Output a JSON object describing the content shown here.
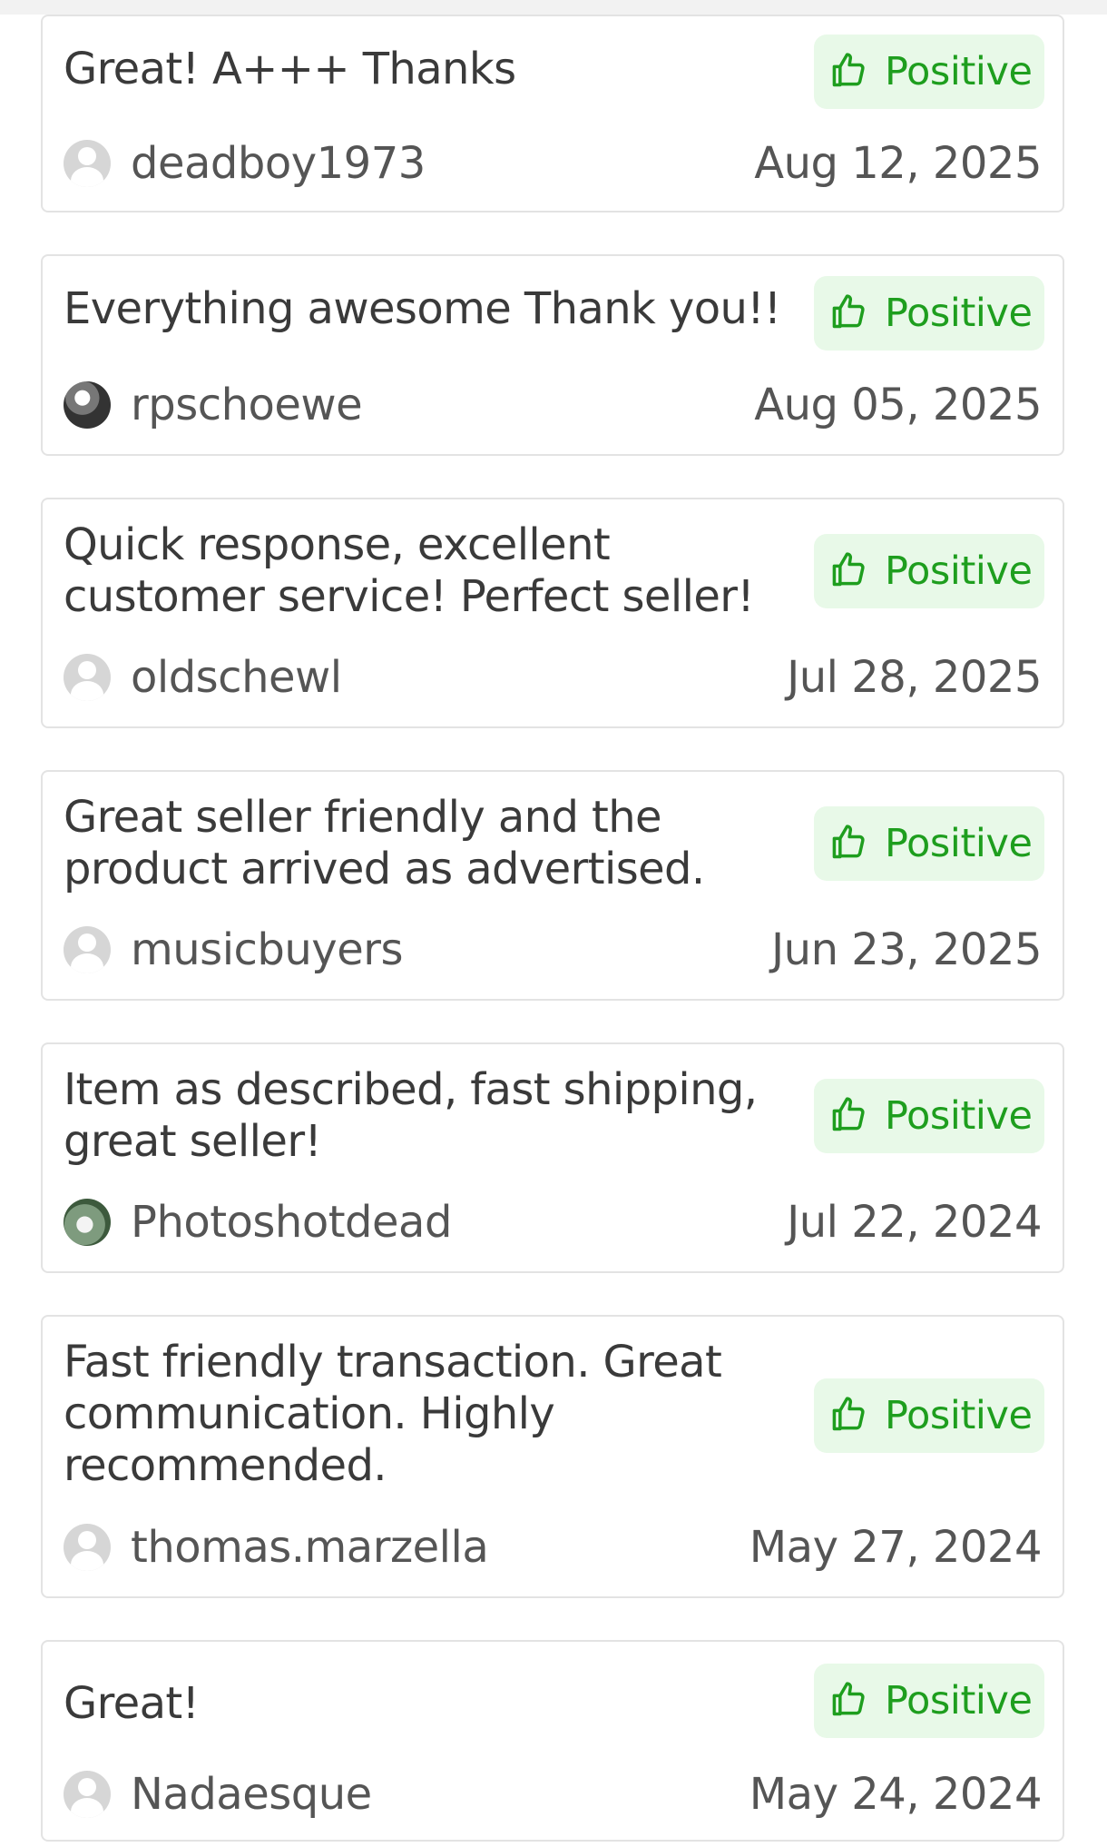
{
  "feedback": [
    {
      "comment": "Great! A+++ Thanks",
      "rating": "Positive",
      "user": "deadboy1973",
      "date": "Aug 12, 2025",
      "avatar_type": "default-avatar"
    },
    {
      "comment": "Everything awesome Thank you!!",
      "rating": "Positive",
      "user": "rpschoewe",
      "date": "Aug 05, 2025",
      "avatar_type": "user-photo"
    },
    {
      "comment": "Quick response, excellent customer service! Perfect seller!",
      "rating": "Positive",
      "user": "oldschewl",
      "date": "Jul 28, 2025",
      "avatar_type": "default-avatar"
    },
    {
      "comment": "Great seller friendly and the product arrived as advertised.",
      "rating": "Positive",
      "user": "musicbuyers",
      "date": "Jun 23, 2025",
      "avatar_type": "default-avatar"
    },
    {
      "comment": "Item as described, fast shipping, great seller!",
      "rating": "Positive",
      "user": "Photoshotdead",
      "date": "Jul 22, 2024",
      "avatar_type": "user-photo"
    },
    {
      "comment": "Fast friendly transaction. Great communication. Highly recommended.",
      "rating": "Positive",
      "user": "thomas.marzella",
      "date": "May 27, 2024",
      "avatar_type": "default-avatar"
    },
    {
      "comment": "Great!",
      "rating": "Positive",
      "user": "Nadaesque",
      "date": "May 24, 2024",
      "avatar_type": "default-avatar"
    }
  ],
  "colors": {
    "positive_text": "#1e9e1e",
    "positive_bg": "#e8f9e8",
    "card_border": "#e3e3e3"
  },
  "icons": {
    "rating": "thumbs-up-icon"
  }
}
